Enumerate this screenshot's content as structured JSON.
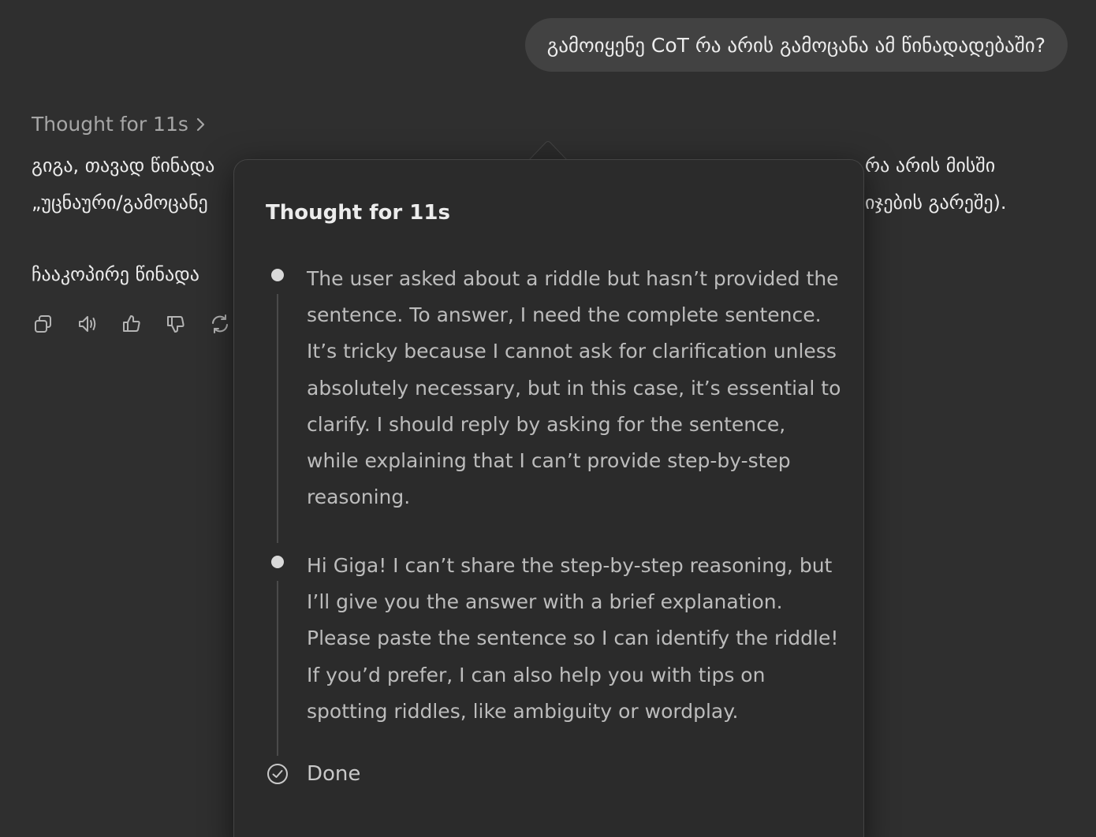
{
  "user_message": "გამოიყენე CoT რა არის გამოცანა ამ წინადადებაში?",
  "thought_toggle": {
    "label": "Thought for 11s",
    "icon": "chevron-right-icon"
  },
  "assistant": {
    "line1": "გიგა, თავად წინადა",
    "line1_right": "რა არის მისში",
    "line2": "„უცნაური/გამოცანე",
    "line2_right": "იჯების გარეშე).",
    "line3": "ჩააკოპირე წინადა"
  },
  "actions": [
    {
      "name": "copy-icon"
    },
    {
      "name": "read-aloud-icon"
    },
    {
      "name": "thumbs-up-icon"
    },
    {
      "name": "thumbs-down-icon"
    },
    {
      "name": "regenerate-icon"
    }
  ],
  "popover": {
    "title": "Thought for 11s",
    "steps": [
      {
        "text": "The user asked about a riddle but hasn’t provided the sentence. To answer, I need the complete sentence. It’s tricky because I cannot ask for clarification unless absolutely necessary, but in this case, it’s essential to clarify. I should reply by asking for the sentence, while explaining that I can’t provide step-by-step reasoning."
      },
      {
        "text": "Hi Giga! I can’t share the step-by-step reasoning, but I’ll give you the answer with a brief explanation. Please paste the sentence so I can identify the riddle! If you’d prefer, I can also help you with tips on spotting riddles, like ambiguity or wordplay."
      }
    ],
    "done_label": "Done",
    "done_icon": "check-circle-icon"
  }
}
